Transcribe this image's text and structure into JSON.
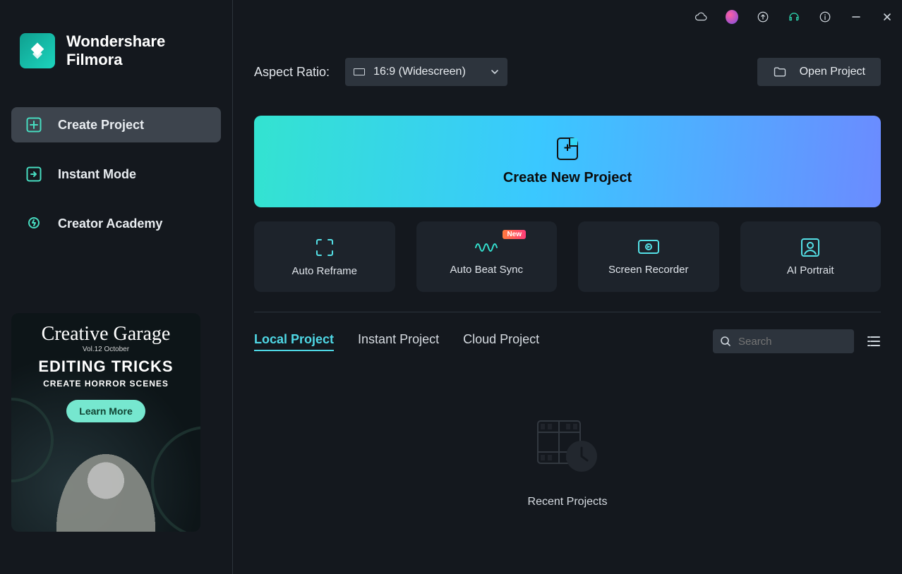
{
  "brand": {
    "line1": "Wondershare",
    "line2": "Filmora"
  },
  "sidebar": {
    "items": [
      {
        "label": "Create Project"
      },
      {
        "label": "Instant Mode"
      },
      {
        "label": "Creator Academy"
      }
    ]
  },
  "promo": {
    "script": "Creative Garage",
    "volume": "Vol.12 October",
    "title": "EDITING TRICKS",
    "subtitle": "CREATE HORROR SCENES",
    "cta": "Learn More"
  },
  "aspect_ratio": {
    "label": "Aspect Ratio:",
    "selected": "16:9 (Widescreen)"
  },
  "open_project_label": "Open Project",
  "create_new_label": "Create New Project",
  "features": [
    {
      "label": "Auto Reframe"
    },
    {
      "label": "Auto Beat Sync",
      "badge": "New"
    },
    {
      "label": "Screen Recorder"
    },
    {
      "label": "AI Portrait"
    }
  ],
  "tabs": [
    {
      "label": "Local Project"
    },
    {
      "label": "Instant Project"
    },
    {
      "label": "Cloud Project"
    }
  ],
  "search": {
    "placeholder": "Search",
    "value": ""
  },
  "recent_label": "Recent Projects",
  "colors": {
    "accent": "#4fd8e6",
    "bg": "#14181e",
    "panel": "#1d232b"
  }
}
